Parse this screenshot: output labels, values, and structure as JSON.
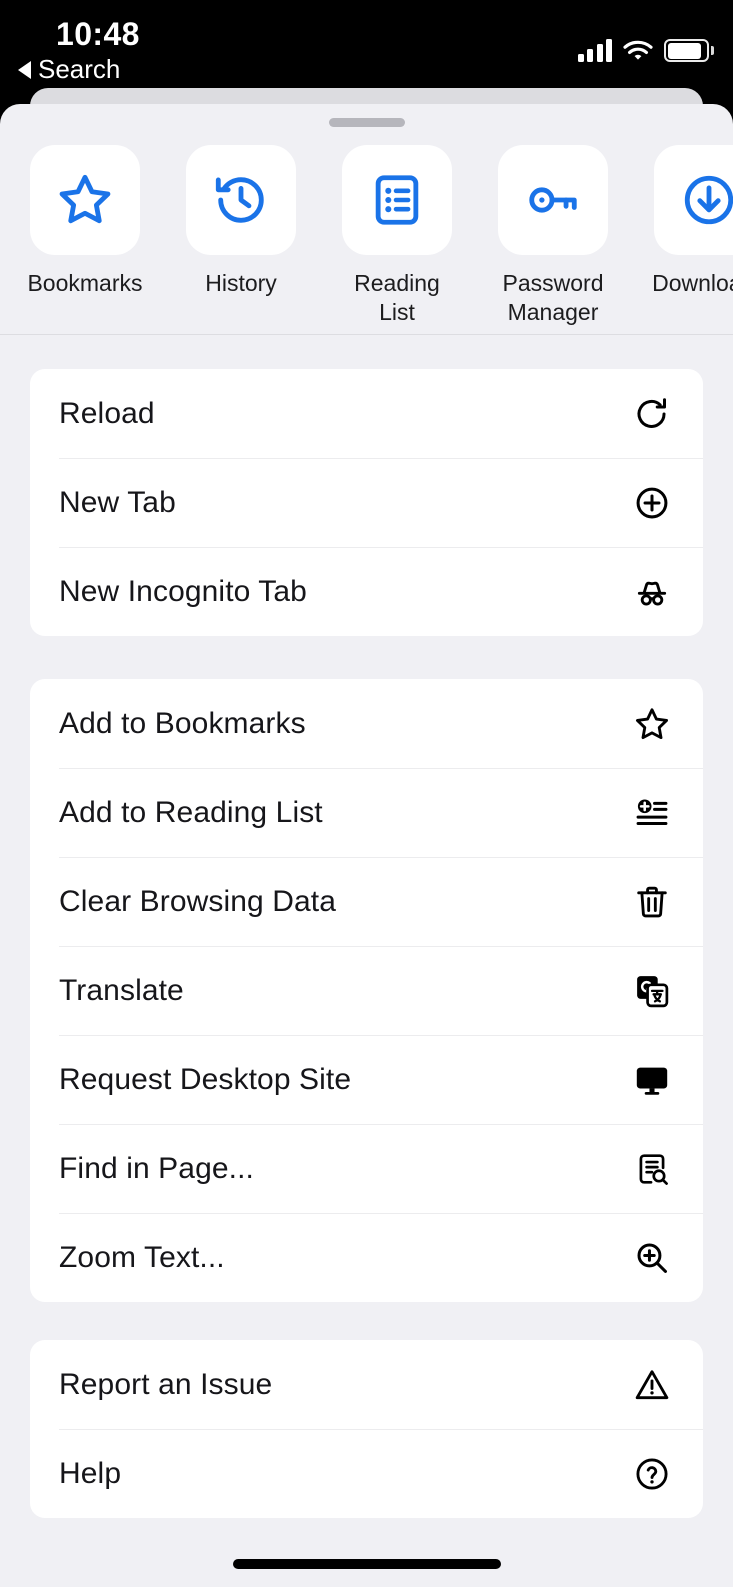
{
  "status_bar": {
    "time": "10:48",
    "back_label": "Search",
    "icons": {
      "cellular": "cellular-signal-icon",
      "wifi": "wifi-icon",
      "battery": "battery-icon"
    }
  },
  "sheet": {
    "grabber": "sheet-grabber"
  },
  "shortcuts": [
    {
      "label": "Bookmarks",
      "icon": "star-outline-icon"
    },
    {
      "label": "History",
      "icon": "history-clock-icon"
    },
    {
      "label": "Reading List",
      "icon": "reading-list-icon"
    },
    {
      "label": "Password Manager",
      "icon": "key-icon"
    },
    {
      "label": "Downloads",
      "icon": "download-circle-icon"
    }
  ],
  "menu_groups": [
    {
      "items": [
        {
          "label": "Reload",
          "icon": "reload-icon"
        },
        {
          "label": "New Tab",
          "icon": "plus-circle-icon"
        },
        {
          "label": "New Incognito Tab",
          "icon": "incognito-icon"
        }
      ]
    },
    {
      "items": [
        {
          "label": "Add to Bookmarks",
          "icon": "star-outline-icon"
        },
        {
          "label": "Add to Reading List",
          "icon": "add-to-reading-list-icon"
        },
        {
          "label": "Clear Browsing Data",
          "icon": "trash-icon"
        },
        {
          "label": "Translate",
          "icon": "translate-icon"
        },
        {
          "label": "Request Desktop Site",
          "icon": "desktop-monitor-icon"
        },
        {
          "label": "Find in Page...",
          "icon": "find-in-page-icon"
        },
        {
          "label": "Zoom Text...",
          "icon": "zoom-in-magnifier-icon"
        }
      ]
    },
    {
      "items": [
        {
          "label": "Report an Issue",
          "icon": "warning-triangle-icon"
        },
        {
          "label": "Help",
          "icon": "help-circle-icon"
        }
      ]
    }
  ],
  "colors": {
    "accent_blue": "#1a73e8",
    "sheet_background": "#f0f0f4",
    "card_background": "#ffffff",
    "text_primary": "#16161a",
    "separator": "#ececee",
    "status_bar_background": "#000000"
  }
}
